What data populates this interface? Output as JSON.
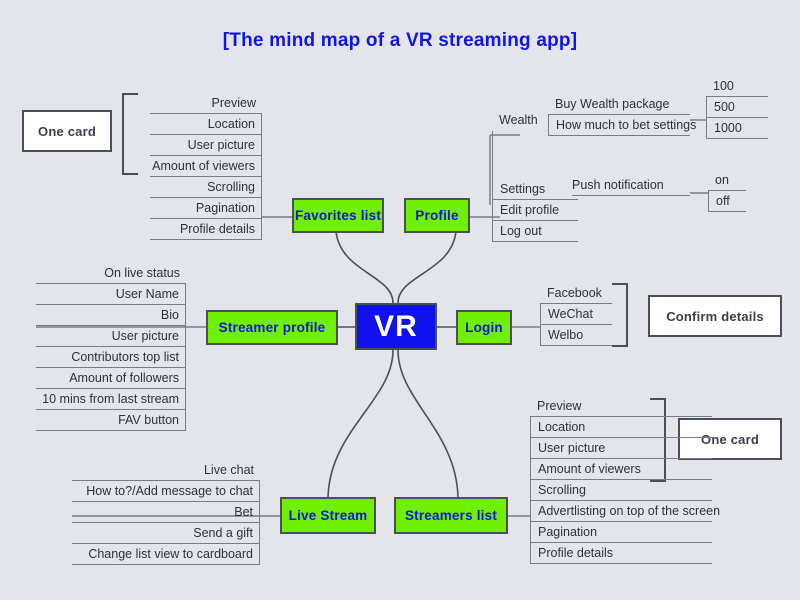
{
  "page": {
    "title": "[The mind map of a VR streaming app]",
    "background": "#e3e5ea",
    "node_green": "#6ef000",
    "node_blue": "#1111ee",
    "text_blue": "#1414e6",
    "line_color": "#4a4f5a"
  },
  "center": {
    "label": "VR"
  },
  "nodes": {
    "favorites_list": "Favorites list",
    "profile": "Profile",
    "streamer_profile": "Streamer profile",
    "login": "Login",
    "live_stream": "Live Stream",
    "streamers_list": "Streamers list"
  },
  "cards": {
    "one_card_top": "One card",
    "confirm_details": "Confirm details",
    "one_card_bottom": "One card"
  },
  "favorites_items": [
    "Preview",
    "Location",
    "User picture",
    "Amount of viewers",
    "Scrolling",
    "Pagination",
    "Profile details"
  ],
  "profile_items": [
    "Wealth",
    "Settings",
    "Edit profile",
    "Log out"
  ],
  "wealth_items": [
    "Buy Wealth package",
    "How much to bet settings"
  ],
  "wealth_amounts": [
    "100",
    "500",
    "1000"
  ],
  "settings_items": [
    "Push notification"
  ],
  "push_options": [
    "on",
    "off"
  ],
  "streamer_profile_items": [
    "On live status",
    "User Name",
    "Bio",
    "User picture",
    "Contributors top list",
    "Amount of followers",
    "10 mins from last stream",
    "FAV button"
  ],
  "login_items": [
    "Facebook",
    "WeChat",
    "Welbo"
  ],
  "live_stream_items": [
    "Live chat",
    "How to?/Add message to chat",
    "Bet",
    "Send a gift",
    "Change list view to cardboard"
  ],
  "streamers_list_items": [
    "Preview",
    "Location",
    "User picture",
    "Amount of viewers",
    "Scrolling",
    "Advertlisting on top of the screen",
    "Pagination",
    "Profile details"
  ]
}
